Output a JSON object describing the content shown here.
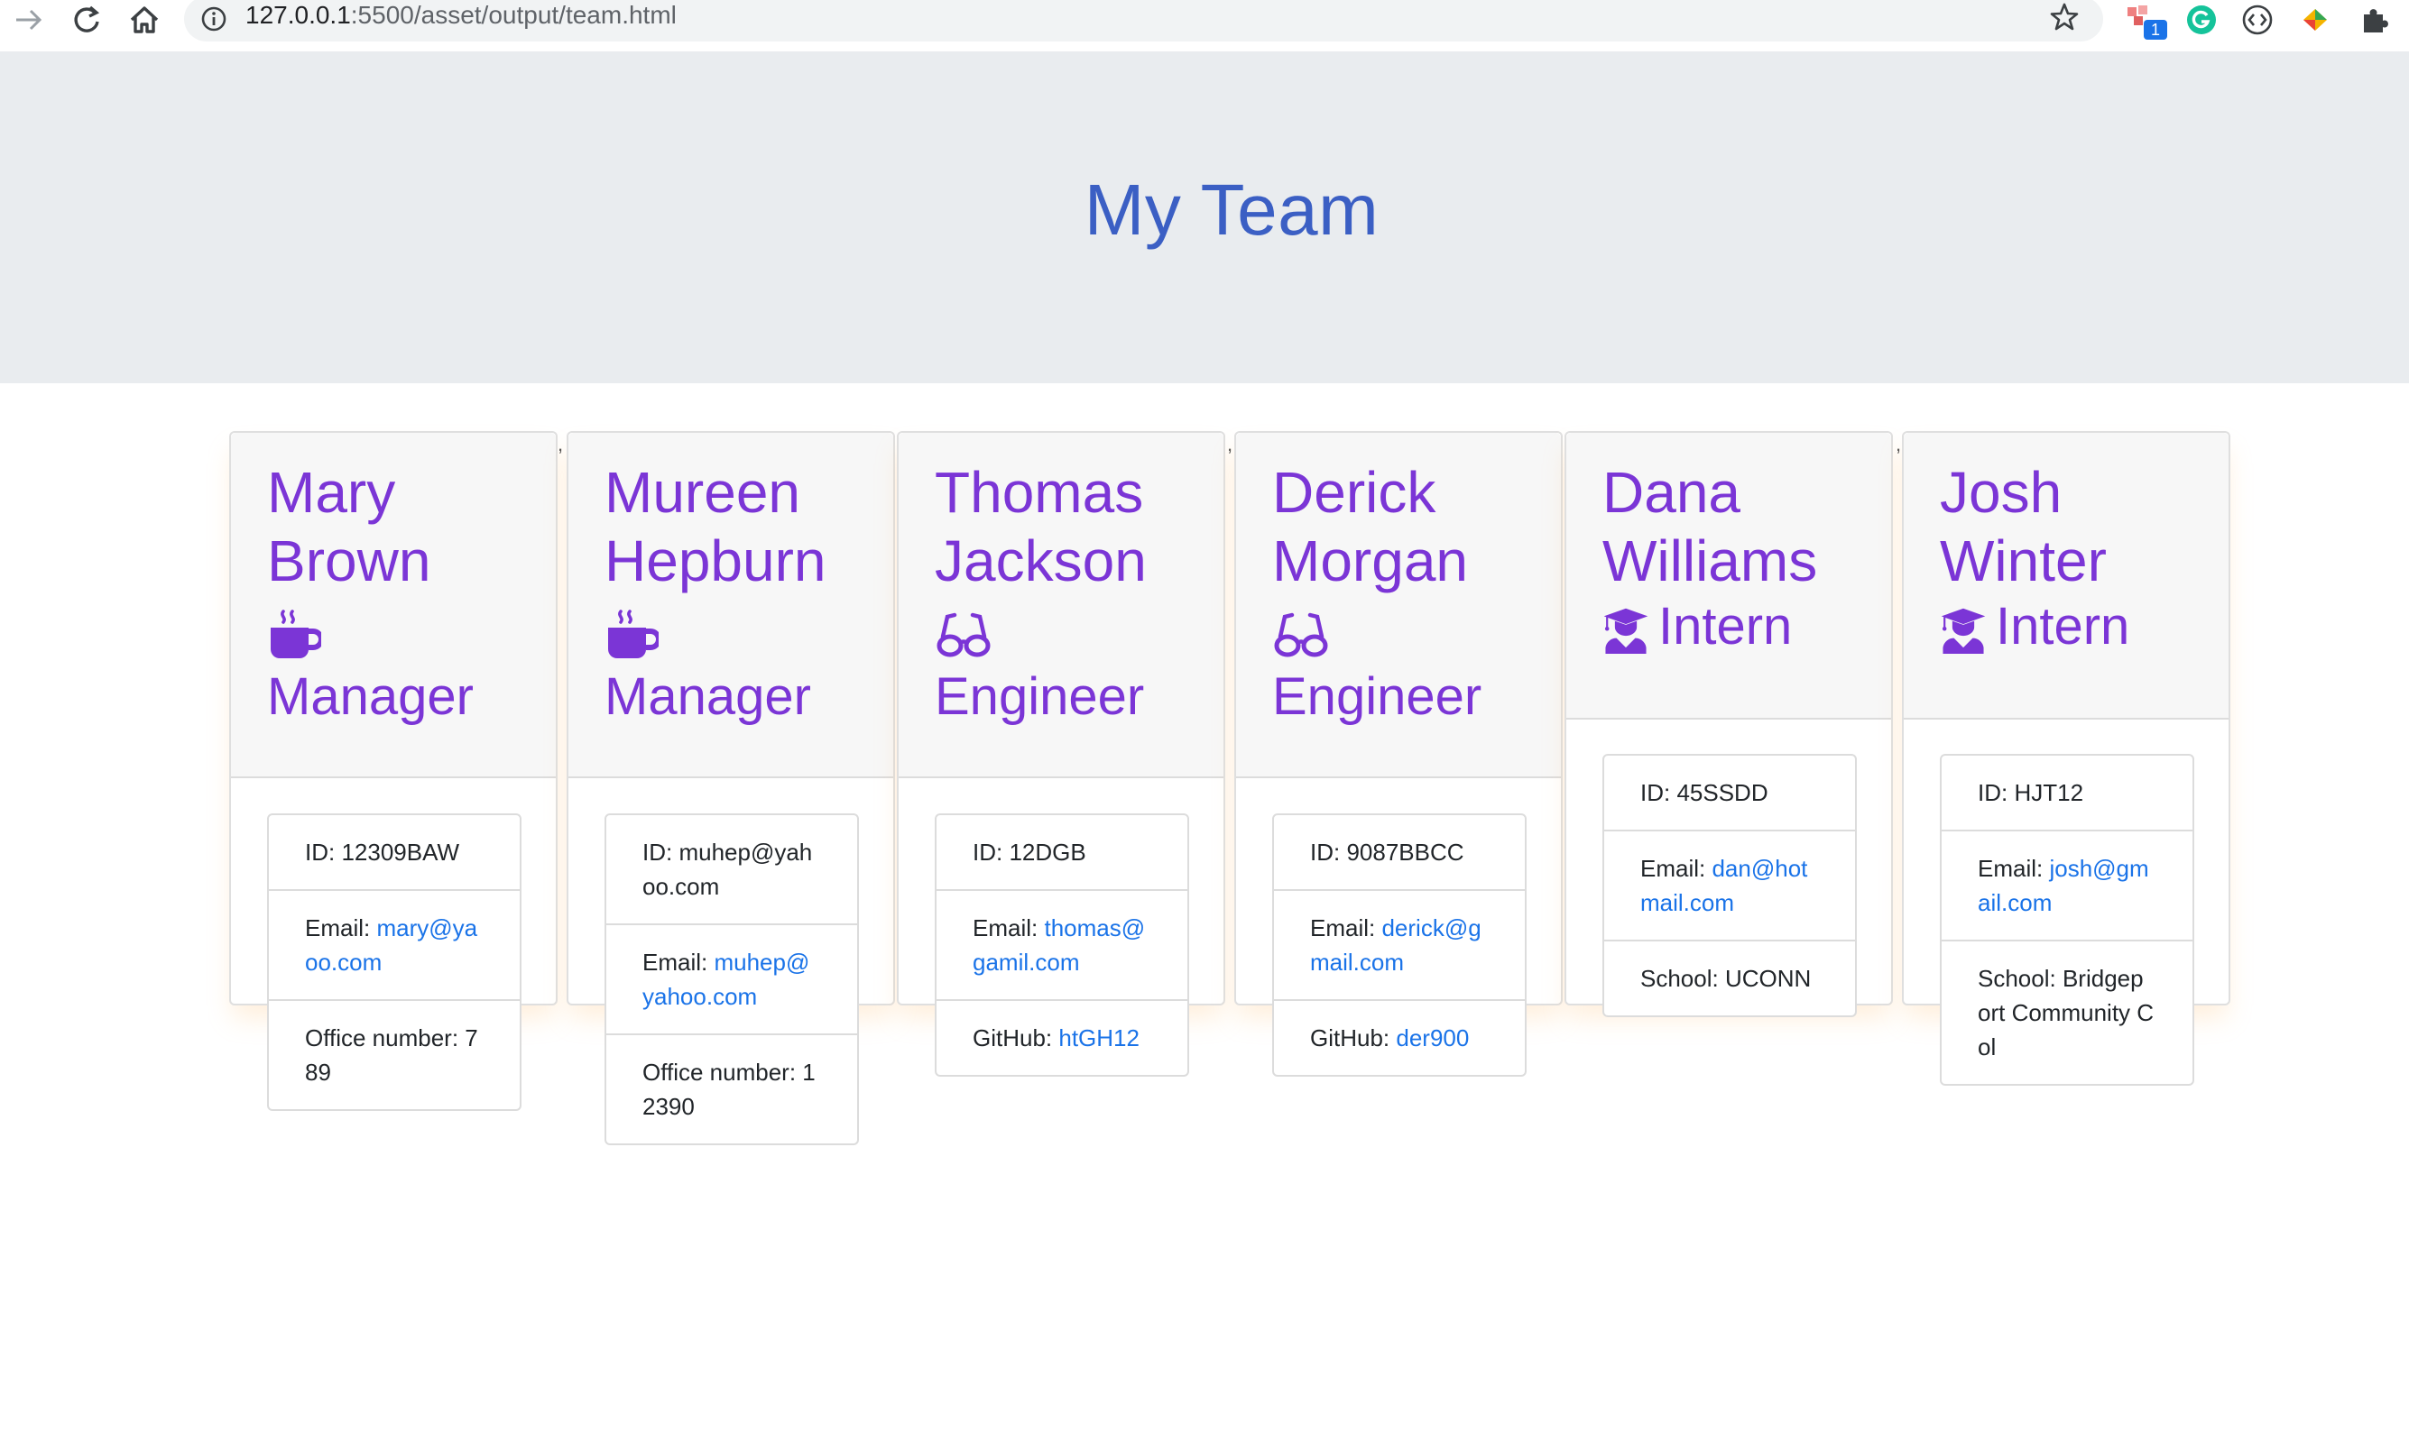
{
  "browser": {
    "url_host": "127.0.0.1",
    "url_path": ":5500/asset/output/team.html",
    "extension_badge": "1"
  },
  "header": {
    "title": "My Team"
  },
  "cards": [
    {
      "name": "Mary Brown",
      "role": "Manager",
      "icon": "coffee-icon",
      "id_label": "ID: 12309BAW",
      "email_prefix": "Email: ",
      "email": "mary@yaoo.com",
      "extra_prefix": "Office number: ",
      "extra": "789"
    },
    {
      "name": "Mureen Hepburn",
      "role": "Manager",
      "icon": "coffee-icon",
      "id_label": "ID: muhep@yahoo.com",
      "email_prefix": "Email: ",
      "email": "muhep@yahoo.com",
      "extra_prefix": "Office number: ",
      "extra": "12390"
    },
    {
      "name": "Thomas Jackson",
      "role": "Engineer",
      "icon": "glasses-icon",
      "id_label": "ID: 12DGB",
      "email_prefix": "Email: ",
      "email": "thomas@gamil.com",
      "extra_prefix": "GitHub: ",
      "extra": "htGH12"
    },
    {
      "name": "Derick Morgan",
      "role": "Engineer",
      "icon": "glasses-icon",
      "id_label": "ID: 9087BBCC",
      "email_prefix": "Email: ",
      "email": "derick@gmail.com",
      "extra_prefix": "GitHub: ",
      "extra": "der900"
    },
    {
      "name": "Dana Williams",
      "role": "Intern",
      "icon": "graduate-icon",
      "id_label": "ID: 45SSDD",
      "email_prefix": "Email: ",
      "email": "dan@hotmail.com",
      "extra_prefix": "School: ",
      "extra": "UCONN"
    },
    {
      "name": "Josh Winter",
      "role": "Intern",
      "icon": "graduate-icon",
      "id_label": "ID: HJT12",
      "email_prefix": "Email: ",
      "email": "josh@gmail.com",
      "extra_prefix": "School: ",
      "extra": "Bridgeport Community Col"
    }
  ],
  "stray_marks": [
    ",",
    ",",
    ","
  ],
  "colors": {
    "accent": "#7b35d6",
    "title": "#3b5fc4",
    "link": "#1a73e8",
    "jumbotron": "#e9ecef"
  }
}
